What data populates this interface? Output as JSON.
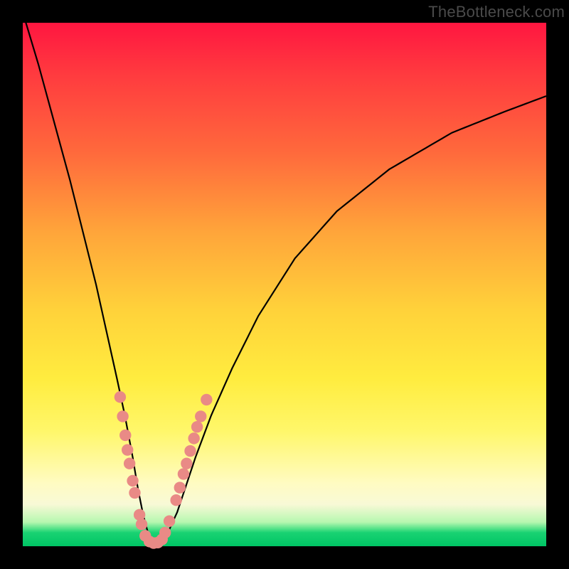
{
  "watermark": "TheBottleneck.com",
  "chart_data": {
    "type": "line",
    "title": "",
    "xlabel": "",
    "ylabel": "",
    "xlim": [
      0,
      100
    ],
    "ylim": [
      0,
      100
    ],
    "series": [
      {
        "name": "bottleneck-curve",
        "x": [
          0,
          3,
          6,
          9,
          12,
          14,
          16,
          18,
          19.5,
          21,
          22,
          23,
          23.8,
          24.5,
          25.2,
          26,
          27,
          28,
          29.5,
          31,
          33,
          36,
          40,
          45,
          52,
          60,
          70,
          82,
          92,
          100
        ],
        "y": [
          102,
          92,
          81,
          70,
          58,
          50,
          41,
          32,
          25,
          17,
          11,
          6,
          3,
          1.2,
          0.5,
          0.5,
          1.3,
          3.2,
          6.5,
          11,
          17,
          25,
          34,
          44,
          55,
          64,
          72,
          79,
          83,
          86
        ]
      }
    ],
    "scatter_points": {
      "name": "series-dots",
      "color": "#e98a86",
      "points": [
        {
          "x": 18.6,
          "y": 28.5
        },
        {
          "x": 19.1,
          "y": 24.8
        },
        {
          "x": 19.6,
          "y": 21.2
        },
        {
          "x": 20.0,
          "y": 18.4
        },
        {
          "x": 20.4,
          "y": 15.8
        },
        {
          "x": 21.0,
          "y": 12.5
        },
        {
          "x": 21.4,
          "y": 10.2
        },
        {
          "x": 22.3,
          "y": 6.0
        },
        {
          "x": 22.7,
          "y": 4.2
        },
        {
          "x": 23.4,
          "y": 2.0
        },
        {
          "x": 24.2,
          "y": 0.9
        },
        {
          "x": 25.0,
          "y": 0.6
        },
        {
          "x": 25.8,
          "y": 0.7
        },
        {
          "x": 26.6,
          "y": 1.3
        },
        {
          "x": 27.2,
          "y": 2.6
        },
        {
          "x": 28.0,
          "y": 4.8
        },
        {
          "x": 29.3,
          "y": 8.8
        },
        {
          "x": 30.0,
          "y": 11.2
        },
        {
          "x": 30.7,
          "y": 13.8
        },
        {
          "x": 31.3,
          "y": 15.8
        },
        {
          "x": 32.0,
          "y": 18.2
        },
        {
          "x": 32.7,
          "y": 20.6
        },
        {
          "x": 33.3,
          "y": 22.8
        },
        {
          "x": 34.0,
          "y": 24.8
        },
        {
          "x": 35.1,
          "y": 28.0
        }
      ]
    }
  }
}
